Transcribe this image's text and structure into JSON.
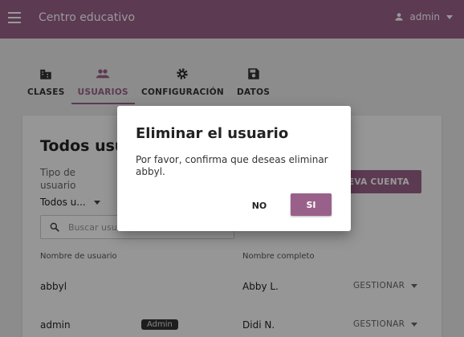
{
  "appbar": {
    "title": "Centro educativo",
    "user": "admin"
  },
  "tabs": [
    {
      "label": "CLASES",
      "icon": "classes-icon"
    },
    {
      "label": "USUARIOS",
      "icon": "people-icon",
      "active": true
    },
    {
      "label": "CONFIGURACIÓN",
      "icon": "gear-icon"
    },
    {
      "label": "DATOS",
      "icon": "save-icon"
    }
  ],
  "page": {
    "title": "Todos usu",
    "filter_label": "Tipo de usuario",
    "filter_value": "Todos u...",
    "new_button": "UEVA CUENTA",
    "search_placeholder": "Buscar usu",
    "columns": {
      "username": "Nombre de usuario",
      "fullname": "Nombre completo"
    },
    "rows": [
      {
        "username": "abbyl",
        "badge": "",
        "fullname": "Abby L.",
        "action": "GESTIONAR"
      },
      {
        "username": "admin",
        "badge": "Admin",
        "fullname": "Didi N.",
        "action": "GESTIONAR"
      }
    ]
  },
  "dialog": {
    "title": "Eliminar el usuario",
    "message": "Por favor, confirma que deseas eliminar abbyl.",
    "cancel": "NO",
    "confirm": "SI"
  },
  "colors": {
    "brand": "#996189",
    "overlay": "rgba(0,0,0,0.4)"
  }
}
